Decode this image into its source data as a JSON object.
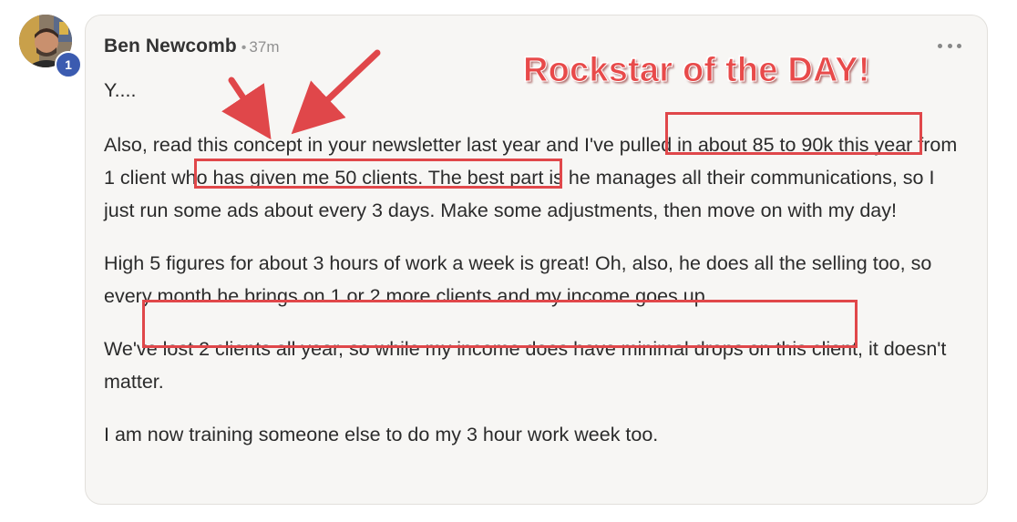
{
  "post": {
    "author": "Ben Newcomb",
    "separator": "•",
    "time": "37m",
    "level": "1",
    "paragraphs": [
      "Y....",
      "Also, read this concept in your newsletter last year and I've pulled in about 85 to 90k this year from 1 client who has given me 50 clients. The best part is he manages all their communications, so I just run some ads about every 3 days. Make some adjustments, then move on with my day!",
      "High 5 figures for about 3 hours of work a week is great! Oh, also, he does all the selling too, so every month he brings on 1 or 2 more clients and my income goes up.",
      "We've lost 2 clients all year, so while my income does have minimal drops on this client, it doesn't matter.",
      "I am now training someone else to do my 3 hour work week too."
    ]
  },
  "annotations": {
    "headline": "Rockstar of the DAY!",
    "color": "#e0474a"
  },
  "icons": {
    "more": "more-horizontal-icon",
    "avatar": "user-avatar"
  }
}
